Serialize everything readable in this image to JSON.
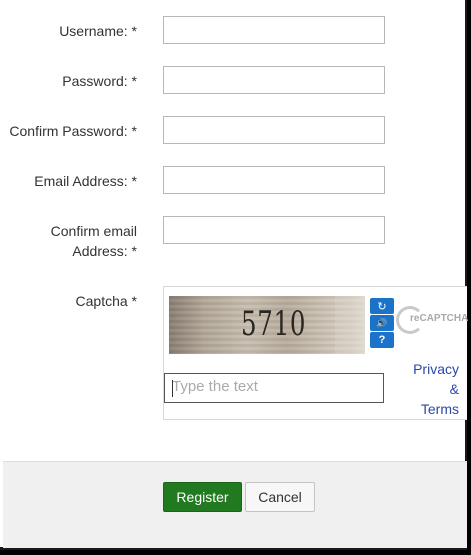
{
  "form": {
    "fields": [
      {
        "label": "Username: *",
        "value": ""
      },
      {
        "label": "Password: *",
        "value": ""
      },
      {
        "label": "Confirm Password: *",
        "value": ""
      },
      {
        "label": "Email Address: *",
        "value": ""
      },
      {
        "label_line1": "Confirm email",
        "label_line2": "Address: *",
        "value": ""
      }
    ],
    "captcha": {
      "label": "Captcha *",
      "image_text": "5710",
      "input_placeholder": "Type the text",
      "logo_text": "reCAPTCHA",
      "link_privacy": "Privacy",
      "link_amp": "&",
      "link_terms": "Terms",
      "refresh_icon": "↻",
      "audio_icon": "🔊",
      "help_icon": "?"
    }
  },
  "footer": {
    "register_label": "Register",
    "cancel_label": "Cancel"
  },
  "colors": {
    "primary": "#217a1f",
    "link": "#2a47a8",
    "captcha_button": "#1a72c9"
  }
}
